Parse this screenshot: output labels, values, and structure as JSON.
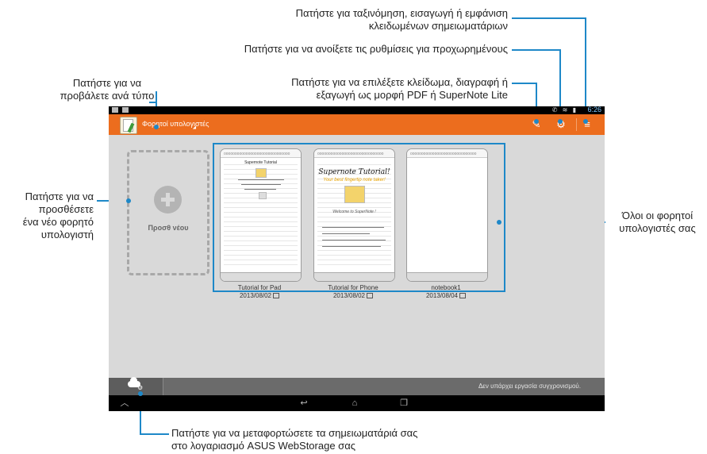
{
  "callouts": {
    "sort": [
      "Πατήστε για ταξινόμηση, εισαγωγή ή εμφάνιση",
      "κλειδωμένων σημειωματάριων"
    ],
    "advanced": "Πατήστε για να ανοίξετε τις ρυθμίσεις για προχωρημένους",
    "lock": [
      "Πατήστε για να επιλέξετε κλείδωμα, διαγραφή ή",
      "εξαγωγή ως μορφή PDF ή SuperNote Lite"
    ],
    "type": [
      "Πατήστε για να",
      "προβάλετε ανά τύπο"
    ],
    "new": [
      "Πατήστε για να",
      "προσθέσετε",
      "ένα νέο φορητό",
      "υπολογιστή"
    ],
    "all": [
      "Όλοι οι φορητοί",
      "υπολογιστές σας"
    ],
    "upload": [
      "Πατήστε για να μεταφορτώσετε τα σημειωματάριά σας",
      "στο λογαριασμό ASUS WebStorage σας"
    ]
  },
  "statusbar": {
    "time": "6:26",
    "icons": "✆ ≋ ▮"
  },
  "appbar": {
    "title": "Φορητοί υπολογιστές",
    "edit_icon": "✎",
    "settings_icon": "⚙",
    "menu_icon": "≡"
  },
  "new_card": {
    "label": "Προσθ νέου"
  },
  "notebooks": [
    {
      "name": "Tutorial for Pad",
      "date": "2013/08/02",
      "page_title": "Supernote Tutorial"
    },
    {
      "name": "Tutorial for Phone",
      "date": "2013/08/02",
      "page_title": "Supernote Tutorial!",
      "page_sub": "Your best fingertip note taker!",
      "page_line": "Welcome to SuperNote !"
    },
    {
      "name": "notebook1",
      "date": "2013/08/04"
    }
  ],
  "sync": {
    "status": "Δεν υπάρχει εργασία συγχρονισμού."
  },
  "nav": {
    "up": "︿",
    "back": "↩",
    "home": "⌂",
    "recent": "❐"
  },
  "colors": {
    "accent": "#ec6d1e",
    "callout_line": "#1e88c8",
    "screen_bg": "#d9d9d9"
  }
}
